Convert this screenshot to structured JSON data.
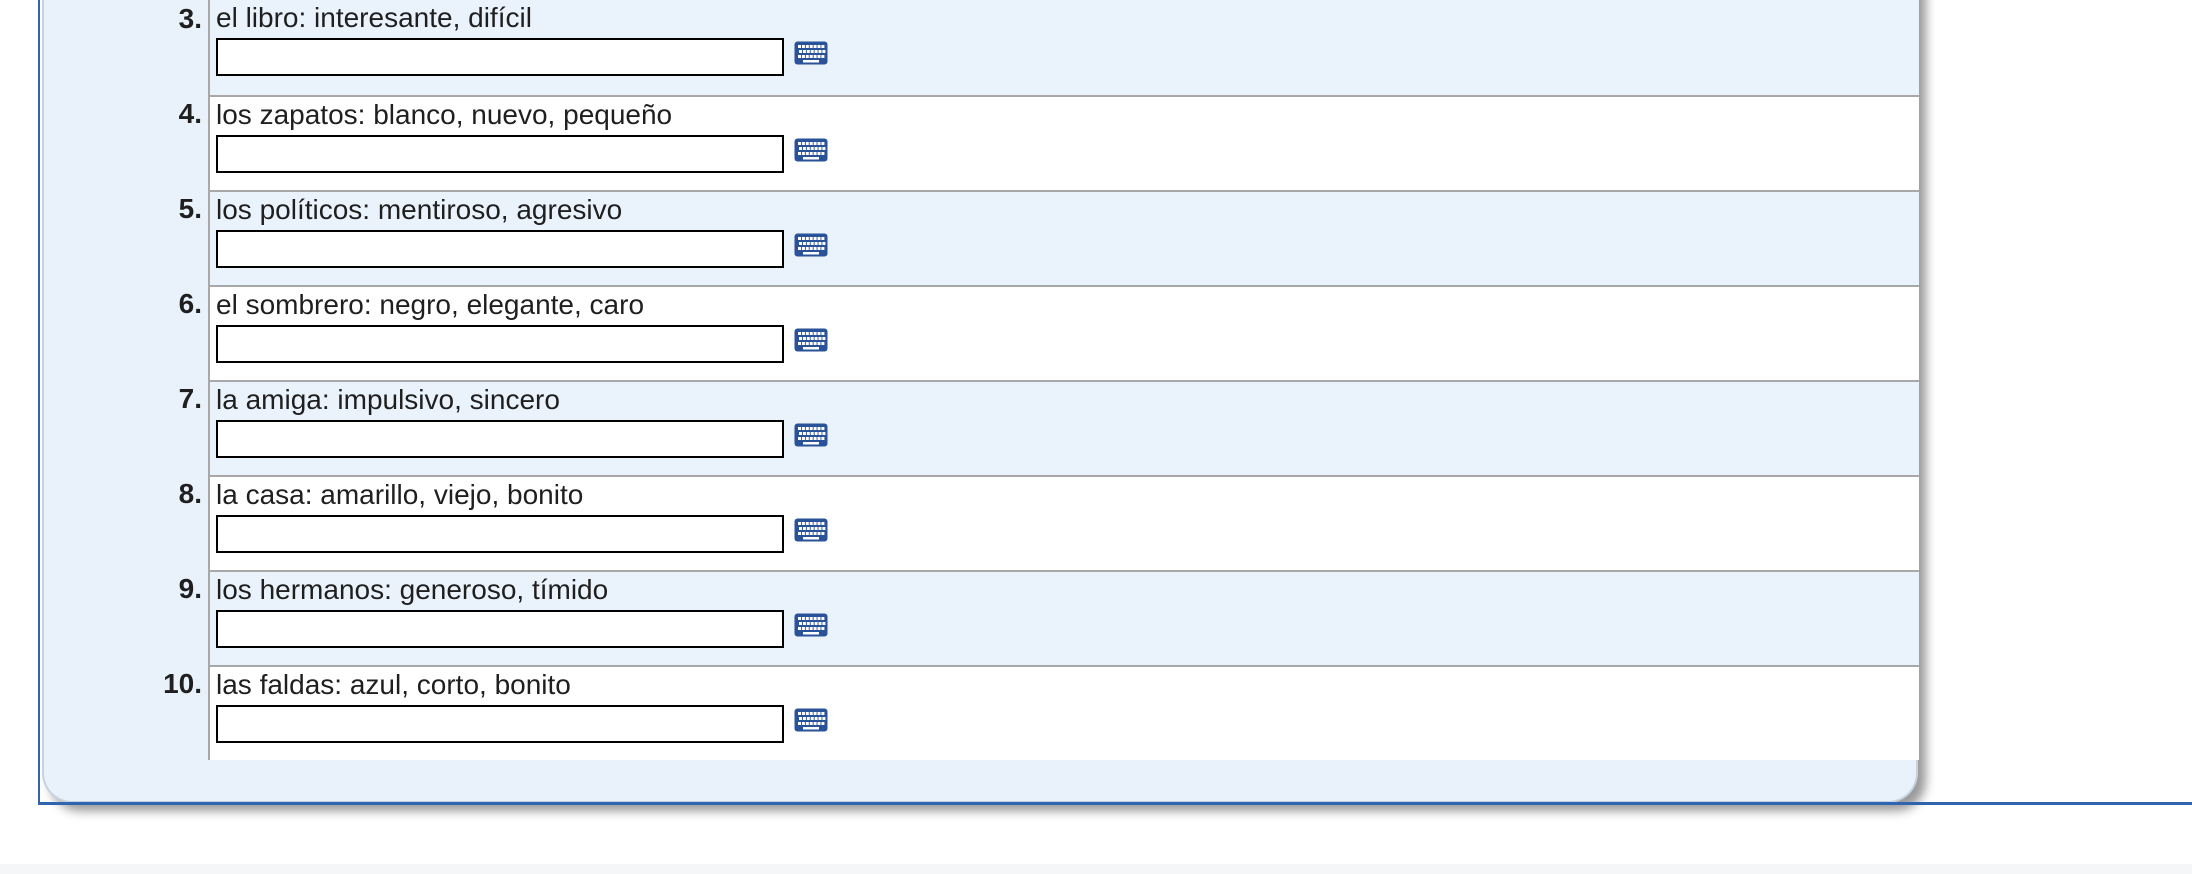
{
  "exercise": {
    "items": [
      {
        "number": "3.",
        "prompt": "el libro: interesante, difícil",
        "answer": "",
        "placeholder": ""
      },
      {
        "number": "4.",
        "prompt": "los zapatos: blanco, nuevo, pequeño",
        "answer": "",
        "placeholder": ""
      },
      {
        "number": "5.",
        "prompt": "los políticos: mentiroso, agresivo",
        "answer": "",
        "placeholder": ""
      },
      {
        "number": "6.",
        "prompt": "el sombrero: negro, elegante, caro",
        "answer": "",
        "placeholder": ""
      },
      {
        "number": "7.",
        "prompt": "la amiga: impulsivo, sincero",
        "answer": "",
        "placeholder": ""
      },
      {
        "number": "8.",
        "prompt": "la casa: amarillo, viejo, bonito",
        "answer": "",
        "placeholder": ""
      },
      {
        "number": "9.",
        "prompt": "los hermanos: generoso, tímido",
        "answer": "",
        "placeholder": ""
      },
      {
        "number": "10.",
        "prompt": "las faldas: azul, corto, bonito",
        "answer": "",
        "placeholder": ""
      }
    ],
    "keyboard_icon": "keyboard-icon"
  },
  "colors": {
    "card_background": "#e9f2fb",
    "row_shade": "#eaf3fc",
    "row_white": "#ffffff",
    "accent_line": "#2f64b0",
    "keyboard_icon": "#2a5298"
  }
}
